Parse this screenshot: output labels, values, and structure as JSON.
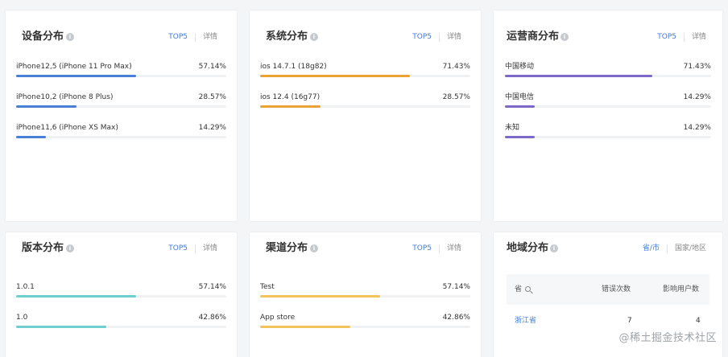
{
  "device": {
    "title": "设备分布",
    "tab": "TOP5",
    "detail": "详情",
    "items": [
      {
        "label": "iPhone12,5 (iPhone 11 Pro Max)",
        "value": "57.14%",
        "pct": 57.14
      },
      {
        "label": "iPhone10,2 (iPhone 8 Plus)",
        "value": "28.57%",
        "pct": 28.57
      },
      {
        "label": "iPhone11,6 (iPhone XS Max)",
        "value": "14.29%",
        "pct": 14.29
      }
    ]
  },
  "system": {
    "title": "系统分布",
    "tab": "TOP5",
    "detail": "详情",
    "items": [
      {
        "label": "ios 14.7.1 (18g82)",
        "value": "71.43%",
        "pct": 71.43
      },
      {
        "label": "ios 12.4 (16g77)",
        "value": "28.57%",
        "pct": 28.57
      }
    ]
  },
  "carrier": {
    "title": "运营商分布",
    "tab": "TOP5",
    "detail": "详情",
    "items": [
      {
        "label": "中国移动",
        "value": "71.43%",
        "pct": 71.43
      },
      {
        "label": "中国电信",
        "value": "14.29%",
        "pct": 14.29
      },
      {
        "label": "未知",
        "value": "14.29%",
        "pct": 14.29
      }
    ]
  },
  "version": {
    "title": "版本分布",
    "tab": "TOP5",
    "detail": "详情",
    "items": [
      {
        "label": "1.0.1",
        "value": "57.14%",
        "pct": 57.14
      },
      {
        "label": "1.0",
        "value": "42.86%",
        "pct": 42.86
      }
    ]
  },
  "channel": {
    "title": "渠道分布",
    "tab": "TOP5",
    "detail": "详情",
    "items": [
      {
        "label": "Test",
        "value": "57.14%",
        "pct": 57.14
      },
      {
        "label": "App store",
        "value": "42.86%",
        "pct": 42.86
      }
    ]
  },
  "region": {
    "title": "地域分布",
    "tab": "省/市",
    "detail": "国家/地区",
    "table": {
      "headers": [
        "省",
        "错误次数",
        "影响用户数"
      ],
      "rows": [
        {
          "province": "浙江省",
          "errors": "7",
          "users": "4"
        }
      ]
    }
  },
  "watermark": "@稀土掘金技术社区",
  "colors": {
    "device": "#4a7fd6",
    "system": "#e9a233",
    "carrier": "#7b68c7",
    "version": "#6fcfd0",
    "channel": "#f2c25b",
    "link": "#3d7bd9"
  }
}
